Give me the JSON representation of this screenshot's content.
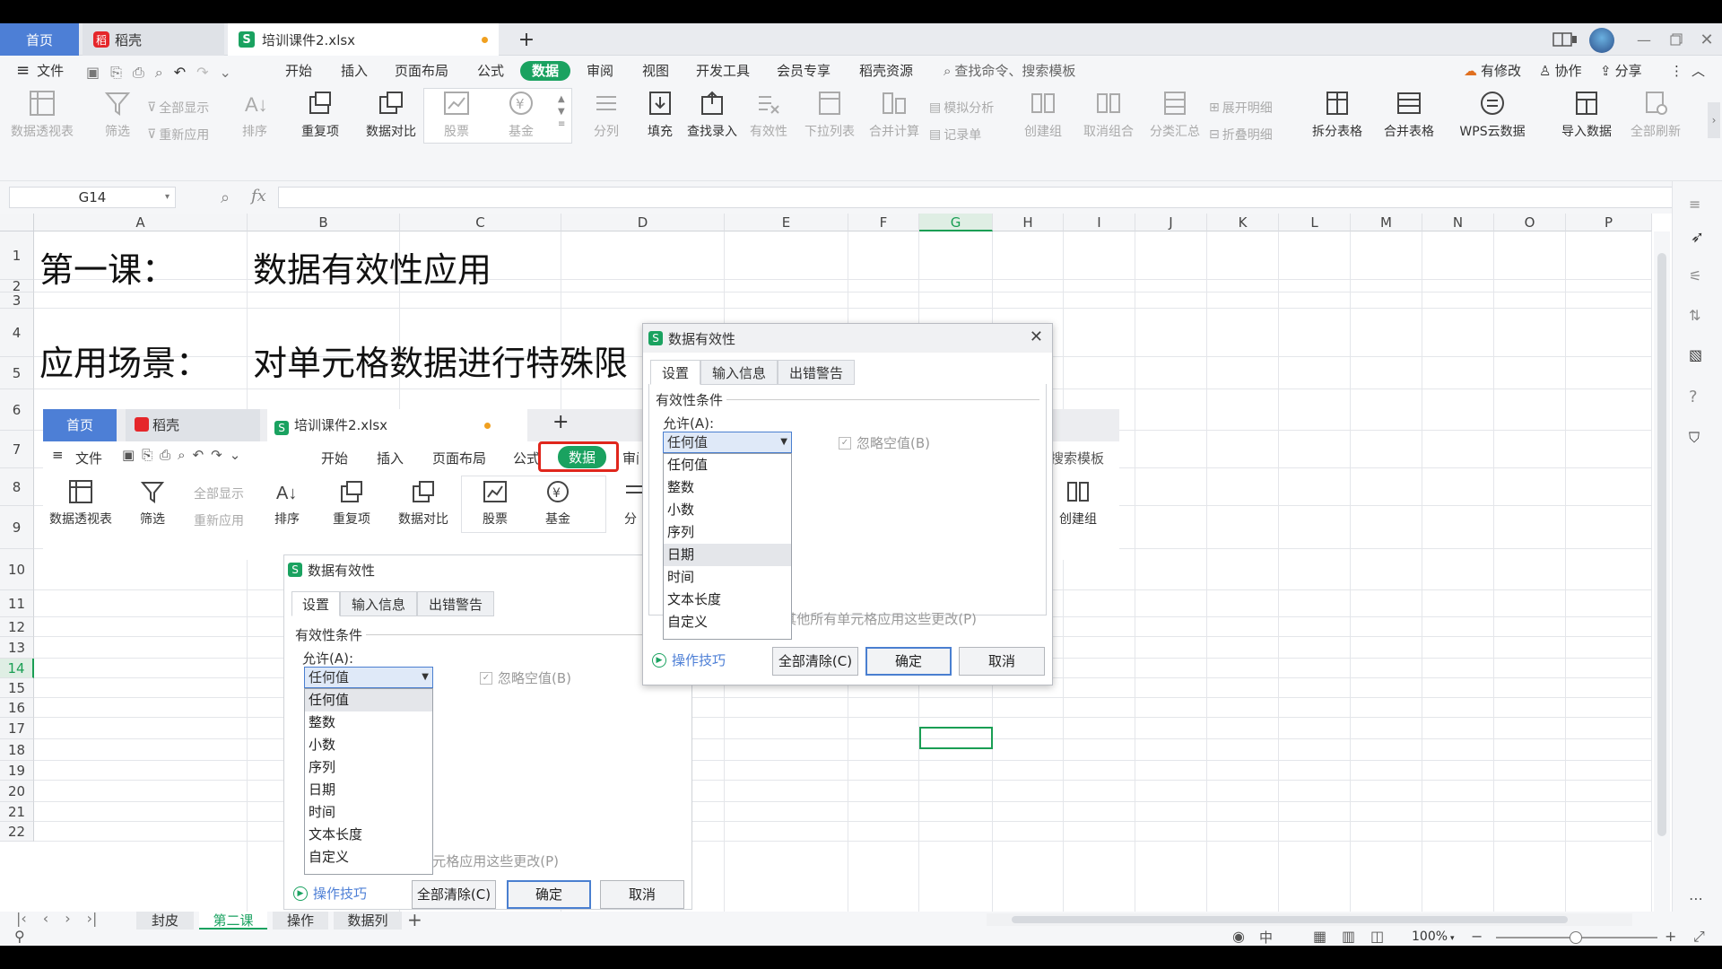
{
  "tabs": {
    "home": "首页",
    "docer": "稻壳",
    "file": "培训课件2.xlsx",
    "add": "+"
  },
  "menu": {
    "file": "文件",
    "items": [
      "开始",
      "插入",
      "页面布局",
      "公式",
      "数据",
      "审阅",
      "视图",
      "开发工具",
      "会员专享",
      "稻壳资源"
    ],
    "search": "查找命令、搜索模板",
    "right": [
      "有修改",
      "协作",
      "分享"
    ]
  },
  "ribbon": {
    "pivot": "数据透视表",
    "filter": "筛选",
    "show_all": "全部显示",
    "reapply": "重新应用",
    "sort": "排序",
    "dup": "重复项",
    "compare": "数据对比",
    "stock": "股票",
    "fund": "基金",
    "split": "分列",
    "fill": "填充",
    "lookup": "查找录入",
    "validity": "有效性",
    "dropdown": "下拉列表",
    "consolidate": "合并计算",
    "simulate": "模拟分析",
    "record": "记录单",
    "create_group": "创建组",
    "ungroup": "取消组合",
    "subtotal": "分类汇总",
    "expand": "展开明细",
    "collapse": "折叠明细",
    "split_table": "拆分表格",
    "merge_table": "合并表格",
    "wps_cloud": "WPS云数据",
    "import": "导入数据",
    "refresh_all": "全部刷新"
  },
  "formula": {
    "cell_ref": "G14",
    "fx": "fx"
  },
  "grid": {
    "columns": [
      "A",
      "B",
      "C",
      "D",
      "E",
      "F",
      "G",
      "H",
      "I",
      "J",
      "K",
      "L",
      "M",
      "N",
      "O",
      "P"
    ],
    "rows": [
      "1",
      "2",
      "3",
      "4",
      "5",
      "6",
      "7",
      "8",
      "9",
      "10",
      "11",
      "12",
      "13",
      "14",
      "15",
      "16",
      "17",
      "18",
      "19",
      "20",
      "21",
      "22"
    ],
    "a1": "第一课：",
    "b1": "数据有效性应用",
    "a4": "应用场景：",
    "b4": "对单元格数据进行特殊限"
  },
  "embedded": {
    "home": "首页",
    "docer": "稻壳",
    "file": "培训课件2.xlsx",
    "add": "+",
    "file_menu": "文件",
    "menu": [
      "开始",
      "插入",
      "页面布局",
      "公式"
    ],
    "data_tab": "数据",
    "review_partial": "审阅",
    "search_partial": "、搜索模板",
    "pivot": "数据透视表",
    "filter": "筛选",
    "show_all": "全部显示",
    "reapply": "重新应用",
    "sort": "排序",
    "dup": "重复项",
    "compare": "数据对比",
    "stock": "股票",
    "fund": "基金",
    "split_partial": "分",
    "create_group": "创建组"
  },
  "dialog": {
    "title": "数据有效性",
    "tabs": [
      "设置",
      "输入信息",
      "出错警告"
    ],
    "section": "有效性条件",
    "allow_label": "允许(A):",
    "allow_value": "任何值",
    "ignore_blank": "忽略空值(B)",
    "options": [
      "任何值",
      "整数",
      "小数",
      "序列",
      "日期",
      "时间",
      "文本长度",
      "自定义"
    ],
    "apply_all": "其他所有单元格应用这些更改(P)",
    "tips": "操作技巧",
    "clear_all": "全部清除(C)",
    "ok": "确定",
    "cancel": "取消"
  },
  "sheets": {
    "items": [
      "封皮",
      "第二课",
      "操作",
      "数据列"
    ],
    "active": "第二课"
  },
  "status": {
    "zoom": "100%"
  },
  "colors": {
    "accent": "#1aa260",
    "highlight_red": "#e0261c",
    "tab_blue": "#4d7fd6"
  }
}
